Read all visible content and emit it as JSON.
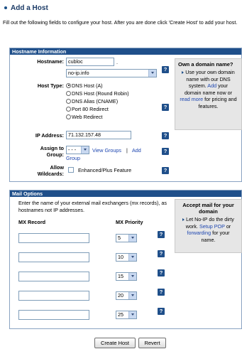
{
  "page": {
    "title": "Add a Host",
    "intro": "Fill out the following fields to configure your host. After you are done click 'Create Host' to add your host."
  },
  "hostname_section": {
    "heading": "Hostname Information",
    "hostname_label": "Hostname:",
    "hostname_value": "cubloc",
    "dot": ".",
    "domain_value": "no-ip.info",
    "host_type_label": "Host Type:",
    "host_types": [
      "DNS Host (A)",
      "DNS Host (Round Robin)",
      "DNS Alias (CNAME)",
      "Port 80 Redirect",
      "Web Redirect"
    ],
    "selected_host_type": "DNS Host (A)",
    "ip_label": "IP Address:",
    "ip_value": "71.132.157.48",
    "assign_label_1": "Assign to",
    "assign_label_2": "Group:",
    "group_value": "- - -",
    "view_groups_link": "View Groups",
    "sep": "|",
    "add_link": "Add",
    "group_link": "Group",
    "allow_label_1": "Allow",
    "allow_label_2": "Wildcards:",
    "wildcard_text": "Enhanced/Plus Feature",
    "help_glyph": "?"
  },
  "domain_box": {
    "title": "Own a domain name?",
    "line1": "Use your own domain",
    "line2": "name with our DNS",
    "line3_a": "system.",
    "line3_link": "Add",
    "line3_b": "your",
    "line4": "domain name now or",
    "line5_link": "read more",
    "line5_b": "for pricing and",
    "line6": "features."
  },
  "mail_section": {
    "heading": "Mail Options",
    "intro": "Enter the name of your external mail exchangers (mx records), as hostnames not IP addresses.",
    "mx_record_label": "MX Record",
    "mx_priority_label": "MX Priority",
    "rows": [
      {
        "record": "",
        "priority": "5"
      },
      {
        "record": "",
        "priority": "10"
      },
      {
        "record": "",
        "priority": "15"
      },
      {
        "record": "",
        "priority": "20"
      },
      {
        "record": "",
        "priority": "25"
      }
    ],
    "help_glyph": "?"
  },
  "mail_box": {
    "title1": "Accept mail for your",
    "title2": "domain",
    "line1": "Let No-IP do the dirty",
    "line2_a": "work.",
    "line2_link": "Setup POP",
    "line2_b": "or",
    "line3_link": "forwarding",
    "line3_b": "for your",
    "line4": "name."
  },
  "buttons": {
    "create": "Create Host",
    "revert": "Revert"
  },
  "colors": {
    "section_header": "#1f4f8a",
    "link": "#1d46b0",
    "sidebox_bg": "#e6e6e6"
  },
  "icons": {
    "title_bullet": "bullet-icon",
    "help": "help-question-icon",
    "dropdown": "chevron-down-icon"
  }
}
